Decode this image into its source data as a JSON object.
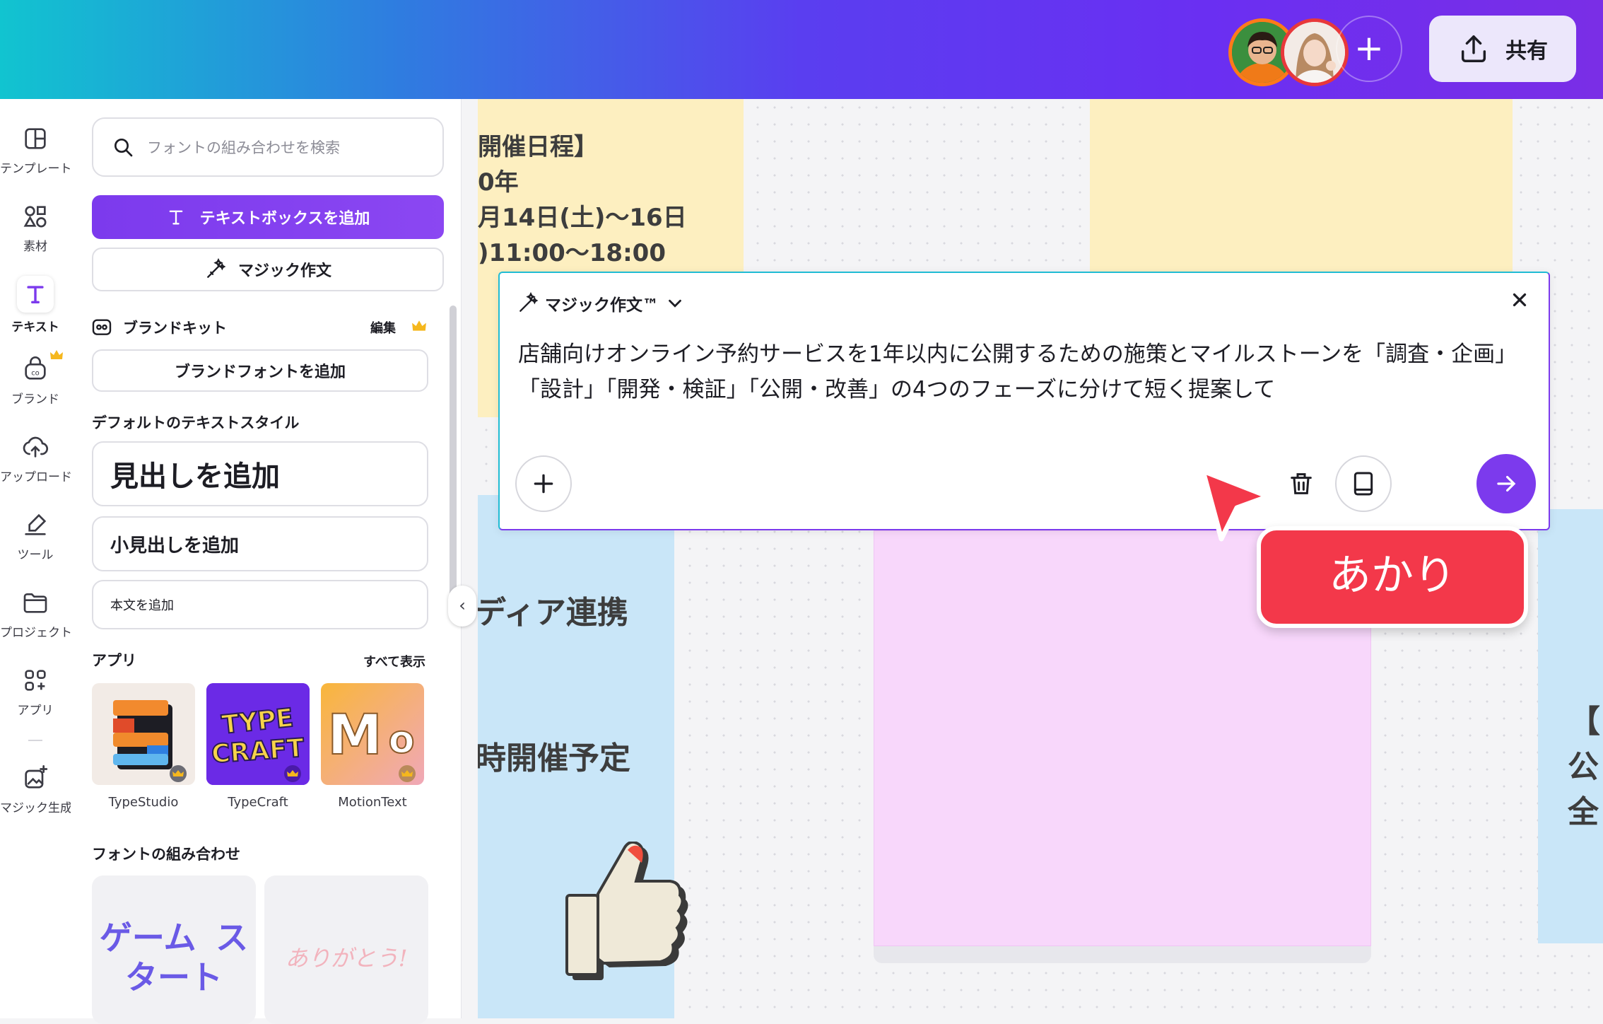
{
  "topbar": {
    "collaborators": [
      "collaborator-1",
      "collaborator-2"
    ],
    "add_symbol": "+",
    "share_label": "共有"
  },
  "rail": {
    "items": [
      {
        "label": "テンプレート",
        "icon": "template-icon"
      },
      {
        "label": "素材",
        "icon": "elements-icon"
      },
      {
        "label": "テキスト",
        "icon": "text-icon"
      },
      {
        "label": "ブランド",
        "icon": "brand-icon"
      },
      {
        "label": "アップロード",
        "icon": "upload-icon"
      },
      {
        "label": "ツール",
        "icon": "draw-tool-icon"
      },
      {
        "label": "プロジェクト",
        "icon": "folder-icon"
      },
      {
        "label": "アプリ",
        "icon": "apps-icon"
      },
      {
        "label": "マジック生成",
        "icon": "magic-media-icon"
      }
    ],
    "active": "テキスト"
  },
  "panel": {
    "search_placeholder": "フォントの組み合わせを検索",
    "add_textbox_label": "テキストボックスを追加",
    "magic_write_label": "マジック作文",
    "brandkit_title": "ブランドキット",
    "brandkit_edit": "編集",
    "add_brand_font": "ブランドフォントを追加",
    "default_styles_title": "デフォルトのテキストスタイル",
    "heading": "見出しを追加",
    "subheading": "小見出しを追加",
    "body": "本文を追加",
    "apps_title": "アプリ",
    "apps_see_all": "すべて表示",
    "apps": [
      {
        "name": "TypeStudio"
      },
      {
        "name": "TypeCraft",
        "logo_text": "TYPE CRAFT"
      },
      {
        "name": "MotionText",
        "logo_text": "Mo"
      }
    ],
    "font_combos_title": "フォントの組み合わせ",
    "font_combos": [
      "ゲーム スタート",
      "ありがとう!"
    ]
  },
  "canvas": {
    "note1_lines": [
      "開催日程】",
      "0年",
      "月14日(土)〜16日",
      ")11:00〜18:00"
    ],
    "note_blue_1": "ディア連携",
    "note_blue_2": "時開催予定",
    "note_right_lines": [
      "【",
      "公",
      "全"
    ],
    "colors": {
      "yellow": "#fdefc0",
      "blue": "#c9e6f8",
      "pink": "#f8d7fb"
    }
  },
  "magic_write": {
    "title": "マジック作文™",
    "prompt": "店舗向けオンライン予約サービスを1年以内に公開するための施策とマイルストーンを「調査・企画」「設計」「開発・検証」「公開・改善」の4つのフェーズに分けて短く提案して",
    "accent": "#7c3aed"
  },
  "cursor_label": "あかり",
  "cursor_color": "#f3384a"
}
